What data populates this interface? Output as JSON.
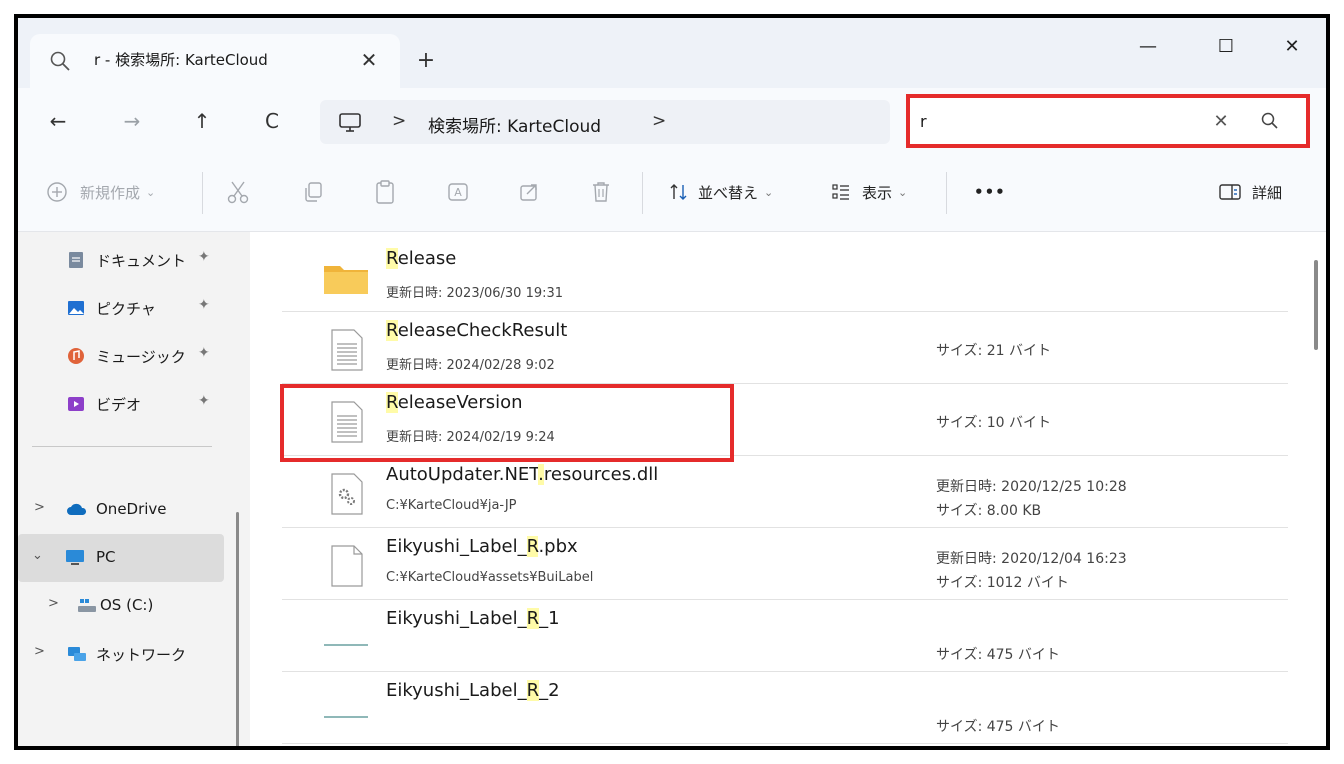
{
  "tab": {
    "title": "r - 検索場所: KarteCloud",
    "close": "✕",
    "new_tab": "+"
  },
  "window": {
    "minimize": "—",
    "maximize": "☐",
    "close": "✕"
  },
  "nav": {
    "back": "←",
    "forward": "→",
    "up": "↑",
    "refresh": "C"
  },
  "address": {
    "sep1": ">",
    "crumb": "検索場所: KarteCloud",
    "sep2": ">"
  },
  "search": {
    "value": "r",
    "clear": "✕"
  },
  "toolbar": {
    "new_label": "新規作成",
    "sort_label": "並べ替え",
    "view_label": "表示",
    "more_label": "•••",
    "details_label": "詳細"
  },
  "sidebar": {
    "quick_access": [
      {
        "label": "ドキュメント",
        "icon": "documents-icon"
      },
      {
        "label": "ピクチャ",
        "icon": "pictures-icon"
      },
      {
        "label": "ミュージック",
        "icon": "music-icon"
      },
      {
        "label": "ビデオ",
        "icon": "videos-icon"
      }
    ],
    "onedrive": "OneDrive",
    "pc": "PC",
    "os": "OS (C:)",
    "network": "ネットワーク",
    "expand_glyph": ">",
    "collapse_glyph": "⌄",
    "pin_glyph": "📌"
  },
  "files": [
    {
      "name_hl": "R",
      "name_rest": "elease",
      "sub": "更新日時: 2023/06/30 19:31",
      "meta1": "",
      "meta2": "",
      "type": "folder"
    },
    {
      "name_hl": "R",
      "name_rest": "eleaseCheckResult",
      "sub": "更新日時: 2024/02/28 9:02",
      "meta1": "サイズ: 21 バイト",
      "meta2": "",
      "type": "text"
    },
    {
      "name_hl": "R",
      "name_rest": "eleaseVersion",
      "sub": "更新日時: 2024/02/19 9:24",
      "meta1": "サイズ: 10 バイト",
      "meta2": "",
      "type": "text"
    },
    {
      "name_pre": "AutoUpdater.NET",
      "name_hl": ".",
      "name_rest": "resources.dll",
      "sub": "C:¥KarteCloud¥ja-JP",
      "meta1": "更新日時: 2020/12/25 10:28",
      "meta2": "サイズ: 8.00 KB",
      "type": "dll"
    },
    {
      "name_pre": "Eikyushi_Label_",
      "name_hl": "R",
      "name_rest": ".pbx",
      "sub": "C:¥KarteCloud¥assets¥BuiLabel",
      "meta1": "更新日時: 2020/12/04 16:23",
      "meta2": "サイズ: 1012 バイト",
      "type": "blank"
    },
    {
      "name_pre": "Eikyushi_Label_",
      "name_hl": "R",
      "name_rest": "_1",
      "sub": "",
      "meta1": "",
      "meta2": "サイズ: 475 バイト",
      "type": "label"
    },
    {
      "name_pre": "Eikyushi_Label_",
      "name_hl": "R",
      "name_rest": "_2",
      "sub": "",
      "meta1": "",
      "meta2": "サイズ: 475 バイト",
      "type": "label"
    }
  ],
  "colors": {
    "highlight_red": "#e52b2b",
    "match_yellow": "#fffba8",
    "folder_yellow": "#f5c542"
  }
}
